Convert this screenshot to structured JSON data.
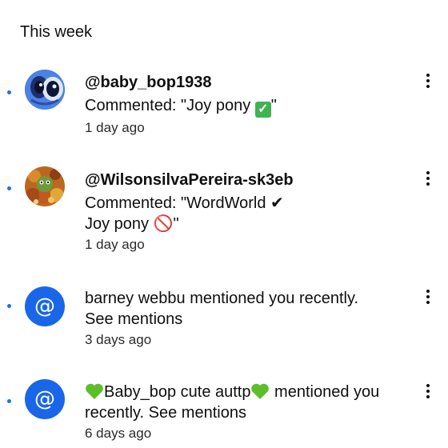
{
  "section": {
    "title": "This week"
  },
  "notifications": [
    {
      "handle": "@baby_bop1938",
      "line1_pre": "Commented: \"Joy pony ",
      "line1_post": "\"",
      "time": "1 day ago",
      "emoji": "check-mark-button"
    },
    {
      "handle": "@WilsonsilvaPereira-sk3eb",
      "line1": "Commented: \"WordWorld ✔",
      "line2": "Joy pony 🚫\"",
      "time": "1 day ago"
    },
    {
      "line1": "barney webbu mentioned you recently.",
      "line2": "See mentions",
      "time": "3 days ago",
      "avatar_glyph": "@"
    },
    {
      "line1_name": "Baby_bop cute auttp",
      "line1_post": " mentioned you",
      "line2": "recently. See mentions",
      "time": "6 days ago",
      "avatar_glyph": "@"
    }
  ],
  "colors": {
    "unread": "#1a73e8",
    "mention_avatar": "#1a66e8",
    "check_green": "#3eb34f",
    "heart_green": "#5cbf2a"
  }
}
